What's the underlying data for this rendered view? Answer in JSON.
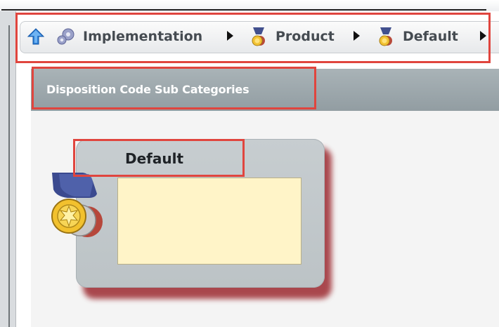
{
  "breadcrumb": {
    "items": [
      {
        "label": "Implementation",
        "icon": "gear-icon"
      },
      {
        "label": "Product",
        "icon": "medal-icon"
      },
      {
        "label": "Default",
        "icon": "medal-icon"
      }
    ],
    "home_icon": "up-arrow-icon",
    "separator_icon": "right-triangle-icon"
  },
  "section": {
    "title": "Disposition Code Sub Categories"
  },
  "card": {
    "title": "Default",
    "icon": "medal-icon"
  },
  "colors": {
    "highlight": "#e0453e",
    "section_header": "#a0aaaf",
    "card_body": "#fff4c8",
    "card_shadow": "#9c2a30"
  }
}
